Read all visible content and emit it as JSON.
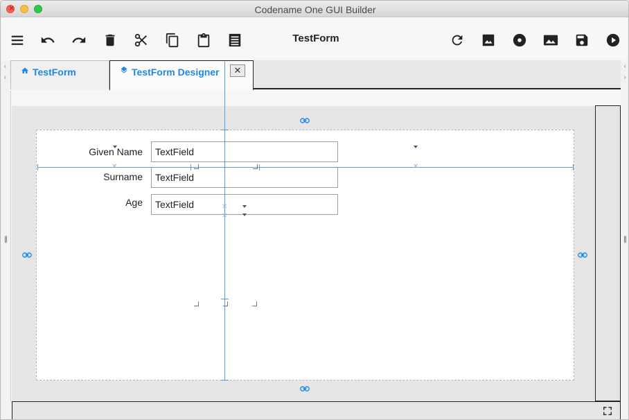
{
  "window": {
    "title": "Codename One GUI Builder"
  },
  "toolbar": {
    "form_title": "TestForm",
    "left_buttons": [
      "menu-icon",
      "undo-icon",
      "redo-icon",
      "delete-icon",
      "cut-icon",
      "copy-icon",
      "paste-icon",
      "list-icon"
    ],
    "right_buttons": [
      "refresh-icon",
      "image-icon",
      "disc-icon",
      "image-icon",
      "save-icon",
      "play-icon"
    ]
  },
  "tabs": [
    {
      "label": "TestForm",
      "icon": "home-icon",
      "active": false
    },
    {
      "label": "TestForm Designer",
      "icon": "layers-icon",
      "active": true,
      "closable": true
    }
  ],
  "tab_close_label": "✕",
  "form": {
    "fields": [
      {
        "label": "Given Name",
        "value": "TextField"
      },
      {
        "label": "Surname",
        "value": "TextField"
      },
      {
        "label": "Age",
        "value": "TextField"
      }
    ]
  },
  "colors": {
    "accent": "#1e88e5",
    "guide": "#5b9bd5"
  }
}
